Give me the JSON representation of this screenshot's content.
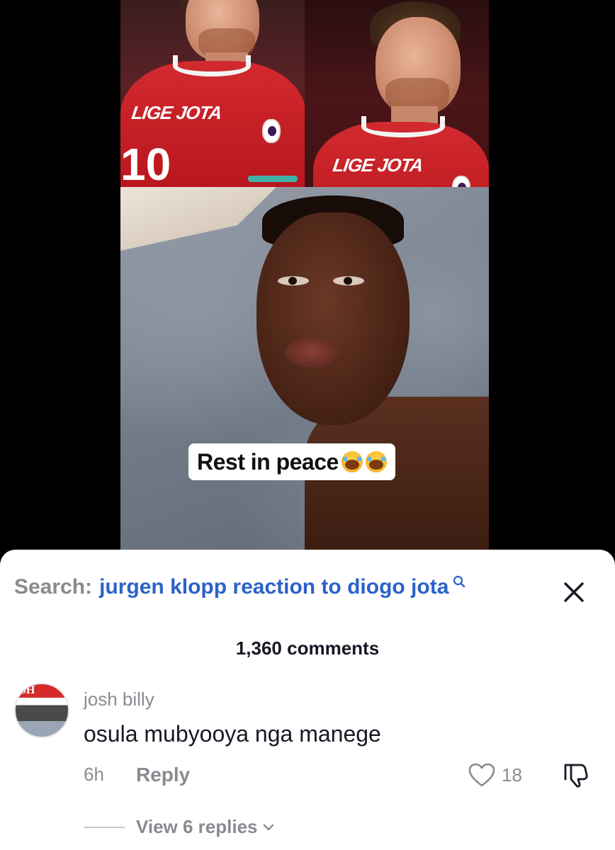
{
  "video": {
    "jersey_name": "LIGE JOTA",
    "jersey_number": "10",
    "caption": "Rest in peace",
    "caption_emojis": [
      "loudly-crying-face",
      "loudly-crying-face"
    ]
  },
  "search": {
    "label": "Search:",
    "query": "jurgen klopp reaction to diogo jota"
  },
  "comments": {
    "count_label": "1,360 comments",
    "items": [
      {
        "username": "josh billy",
        "text": "osula mubyooya nga manege",
        "time": "6h",
        "reply_label": "Reply",
        "likes": "18",
        "view_replies_label": "View 6 replies",
        "avatar_text": "SH"
      }
    ]
  },
  "colors": {
    "link_blue": "#2b62c8",
    "muted_gray": "#8a8b91",
    "text_dark": "#161823"
  }
}
